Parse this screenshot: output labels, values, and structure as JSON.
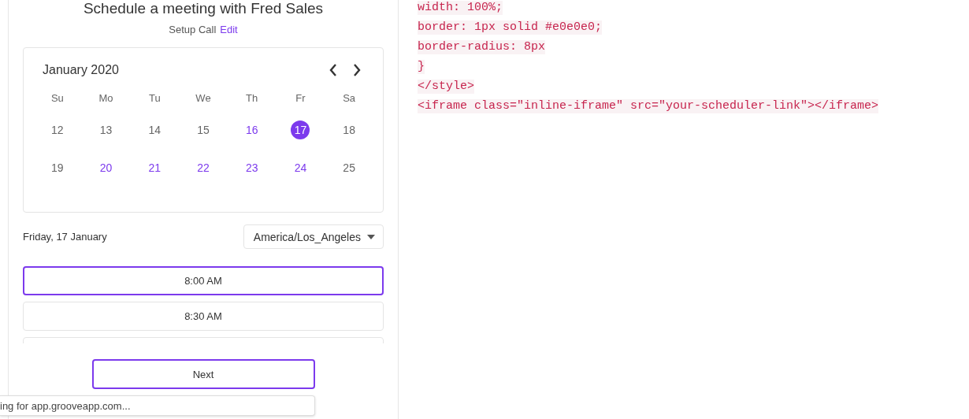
{
  "scheduler": {
    "title": "Schedule a meeting with Fred Sales",
    "meeting_type": "Setup Call",
    "edit_link": "Edit",
    "calendar": {
      "month": "January 2020",
      "weekdays": [
        "Su",
        "Mo",
        "Tu",
        "We",
        "Th",
        "Fr",
        "Sa"
      ],
      "weeks": [
        [
          {
            "day": "12",
            "available": false,
            "selected": false
          },
          {
            "day": "13",
            "available": false,
            "selected": false
          },
          {
            "day": "14",
            "available": false,
            "selected": false
          },
          {
            "day": "15",
            "available": false,
            "selected": false
          },
          {
            "day": "16",
            "available": true,
            "selected": false
          },
          {
            "day": "17",
            "available": true,
            "selected": true
          },
          {
            "day": "18",
            "available": false,
            "selected": false
          }
        ],
        [
          {
            "day": "19",
            "available": false,
            "selected": false
          },
          {
            "day": "20",
            "available": true,
            "selected": false
          },
          {
            "day": "21",
            "available": true,
            "selected": false
          },
          {
            "day": "22",
            "available": true,
            "selected": false
          },
          {
            "day": "23",
            "available": true,
            "selected": false
          },
          {
            "day": "24",
            "available": true,
            "selected": false
          },
          {
            "day": "25",
            "available": false,
            "selected": false
          }
        ]
      ]
    },
    "date_label": "Friday, 17 January",
    "timezone": "America/Los_Angeles",
    "slots": [
      {
        "time": "8:00 AM",
        "selected": true
      },
      {
        "time": "8:30 AM",
        "selected": false
      }
    ],
    "next_button": "Next"
  },
  "status_text": "ing for app.grooveapp.com...",
  "code_lines": [
    "width: 100%;",
    "border: 1px solid #e0e0e0;",
    "border-radius: 8px",
    "}",
    "</style>",
    "<iframe class=\"inline-iframe\" src=\"your-scheduler-link\"></iframe>"
  ]
}
